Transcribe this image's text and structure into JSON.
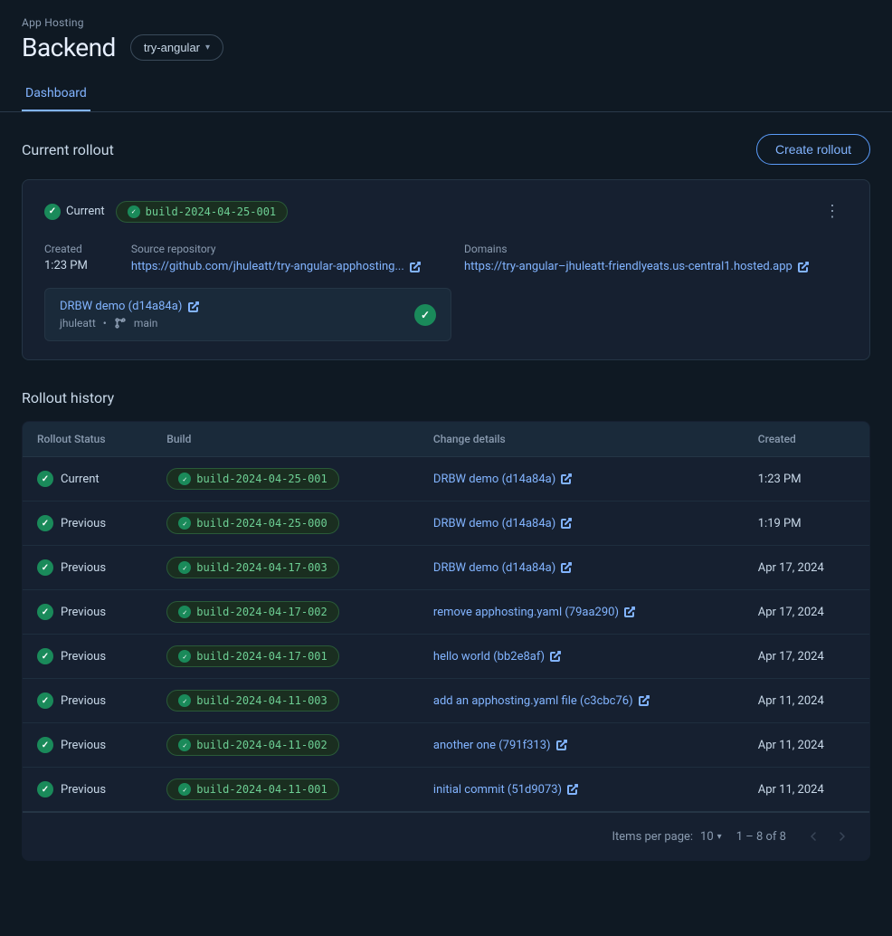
{
  "header": {
    "app_hosting_label": "App Hosting",
    "title": "Backend",
    "dropdown_label": "try-angular"
  },
  "tabs": [
    {
      "id": "dashboard",
      "label": "Dashboard",
      "active": true
    }
  ],
  "current_rollout": {
    "section_title": "Current rollout",
    "create_button_label": "Create rollout",
    "status_label": "Current",
    "build_id": "build-2024-04-25-001",
    "more_icon": "⋮",
    "created_label": "Created",
    "created_value": "1:23 PM",
    "source_repo_label": "Source repository",
    "source_repo_url": "https://github.com/jhuleatt/try-angular-apphosting",
    "source_repo_display": "https://github.com/jhuleatt/try-angular-apphosting...",
    "domains_label": "Domains",
    "domain_url": "https://try-angular–jhuleatt-friendlyeats.us-central1.hosted.app",
    "domain_display": "https://try-angular–jhuleatt-friendlyeats.us-central1.hosted.app",
    "commit": {
      "title": "DRBW demo (d14a84a)",
      "author": "jhuleatt",
      "branch": "main"
    }
  },
  "rollout_history": {
    "section_title": "Rollout history",
    "columns": [
      "Rollout Status",
      "Build",
      "Change details",
      "Created"
    ],
    "rows": [
      {
        "status": "Current",
        "build": "build-2024-04-25-001",
        "change": "DRBW demo (d14a84a)",
        "created": "1:23 PM"
      },
      {
        "status": "Previous",
        "build": "build-2024-04-25-000",
        "change": "DRBW demo (d14a84a)",
        "created": "1:19 PM"
      },
      {
        "status": "Previous",
        "build": "build-2024-04-17-003",
        "change": "DRBW demo (d14a84a)",
        "created": "Apr 17, 2024"
      },
      {
        "status": "Previous",
        "build": "build-2024-04-17-002",
        "change": "remove apphosting.yaml (79aa290)",
        "created": "Apr 17, 2024"
      },
      {
        "status": "Previous",
        "build": "build-2024-04-17-001",
        "change": "hello world (bb2e8af)",
        "created": "Apr 17, 2024"
      },
      {
        "status": "Previous",
        "build": "build-2024-04-11-003",
        "change": "add an apphosting.yaml file (c3cbc76)",
        "created": "Apr 11, 2024"
      },
      {
        "status": "Previous",
        "build": "build-2024-04-11-002",
        "change": "another one (791f313)",
        "created": "Apr 11, 2024"
      },
      {
        "status": "Previous",
        "build": "build-2024-04-11-001",
        "change": "initial commit (51d9073)",
        "created": "Apr 11, 2024"
      }
    ],
    "pagination": {
      "items_per_page_label": "Items per page:",
      "items_per_page_value": "10",
      "page_range": "1 – 8 of 8"
    }
  }
}
